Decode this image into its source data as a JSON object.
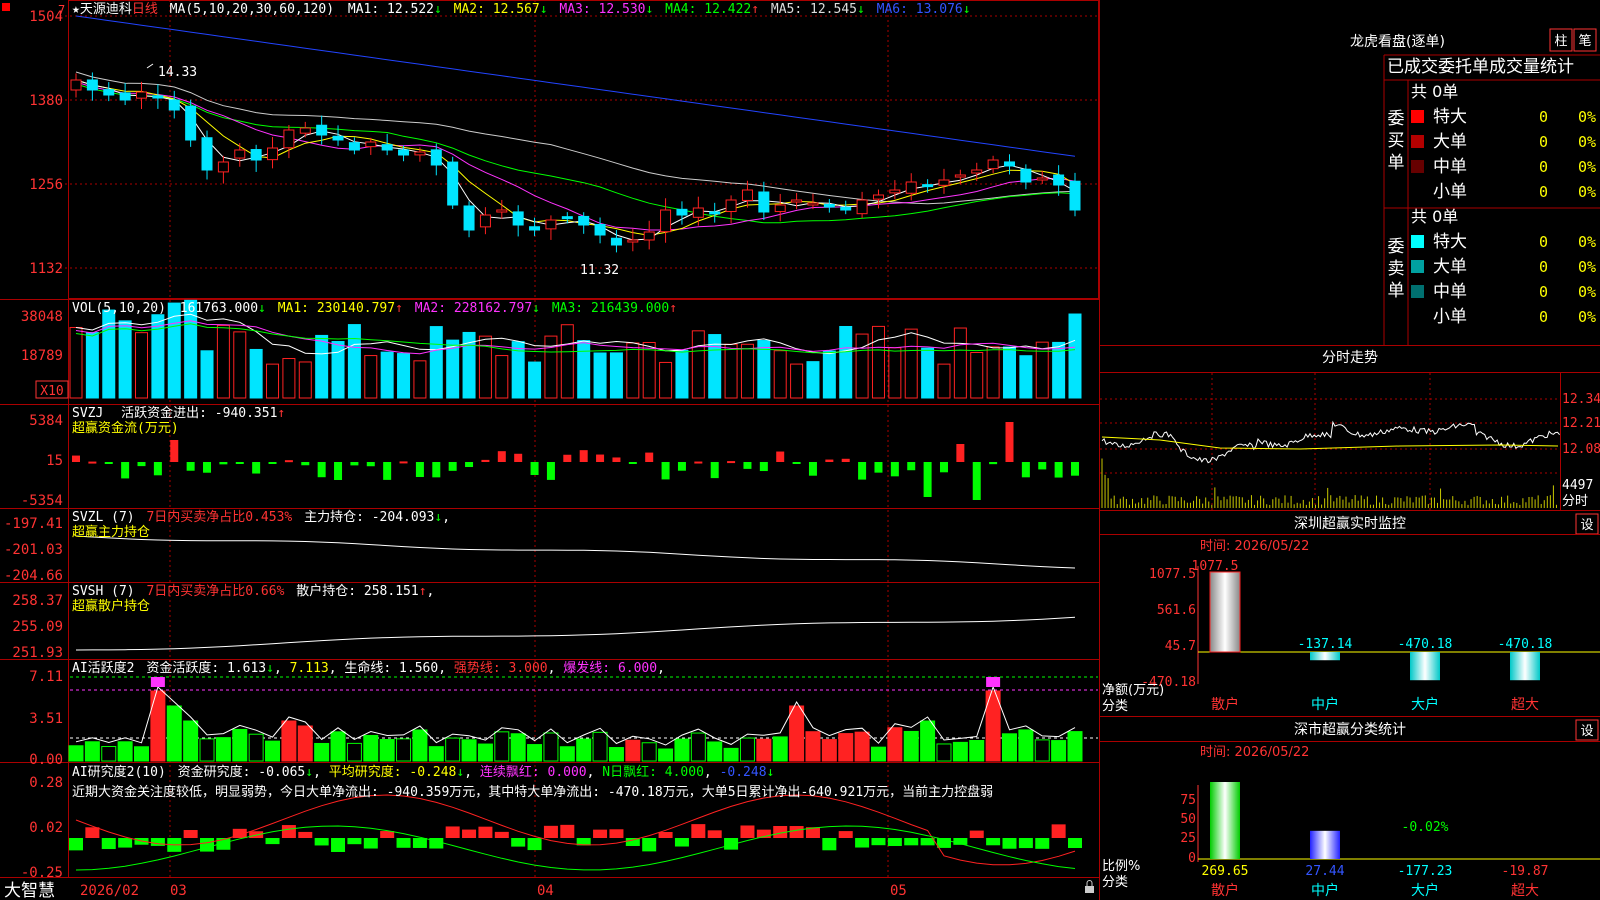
{
  "stock": {
    "name": "★天源迪科",
    "period": "日线",
    "ma_label": "MA(5,10,20,30,60,120)",
    "ma": [
      {
        "label": "MA1: 12.522",
        "arrow": "↓",
        "color": "#ffffff"
      },
      {
        "label": "MA2: 12.567",
        "arrow": "↓",
        "color": "#ffff00"
      },
      {
        "label": "MA3: 12.530",
        "arrow": "↓",
        "color": "#ff33ff"
      },
      {
        "label": "MA4: 12.422",
        "arrow": "↑",
        "color": "#00ff00"
      },
      {
        "label": "MA5: 12.545",
        "arrow": "↓",
        "color": "#dddddd"
      },
      {
        "label": "MA6: 13.076",
        "arrow": "↓",
        "color": "#3355ff"
      }
    ],
    "y_ticks": [
      "1504",
      "1380",
      "1256",
      "1132"
    ],
    "annot_high": "14.33",
    "annot_low": "11.32",
    "top_left_mark": "7"
  },
  "vol": {
    "label": "VOL(5,10,20)",
    "value": "161763.000",
    "value_arrow": "↓",
    "ma": [
      {
        "label": "MA1: 230140.797",
        "arrow": "↑",
        "color": "#ffffff"
      },
      {
        "label": "MA2: 228162.797",
        "arrow": "↓",
        "color": "#ff33ff"
      },
      {
        "label": "MA3: 216439.000",
        "arrow": "↑",
        "color": "#00ff00"
      }
    ],
    "y_ticks": [
      "38048",
      "18789"
    ],
    "unit": "X10"
  },
  "svzj": {
    "label": "SVZJ",
    "field": "活跃资金进出: -940.351",
    "arrow": "↑",
    "sub": "超赢资金流(万元)",
    "y_ticks": [
      "5384",
      "15",
      "-5354"
    ]
  },
  "svzl": {
    "label": "SVZL (7)",
    "ratio": "7日内买卖净占比0.453%",
    "field": "主力持仓: -204.093",
    "arrow": "↓",
    "sub": "超赢主力持仓",
    "y_ticks": [
      "-197.41",
      "-201.03",
      "-204.66"
    ]
  },
  "svsh": {
    "label": "SVSH (7)",
    "ratio": "7日内买卖净占比0.66%",
    "field": "散户持仓: 258.151",
    "arrow": "↑",
    "sub": "超赢散户持仓",
    "y_ticks": [
      "258.37",
      "255.09",
      "251.93"
    ]
  },
  "ai1": {
    "label": "AI活跃度2",
    "field1": "资金活跃度: 1.613",
    "arrow1": "↓",
    "field2": "7.113",
    "field3": "生命线: 1.560",
    "field4": "强势线: 3.000",
    "field5": "爆发线: 6.000",
    "y_ticks": [
      "7.11",
      "3.51",
      "0.00"
    ]
  },
  "ai2": {
    "label": "AI研究度2(10)",
    "field1": "资金研究度: -0.065",
    "arrow1": "↓",
    "field2": "平均研究度: -0.248",
    "arrow2": "↓",
    "field3": "连续飘红: 0.000",
    "field4": "N日飘红: 4.000",
    "field5": "-0.248",
    "note": "近期大资金关注度较低，明显弱势，今日大单净流出: -940.359万元，其中特大单净流出: -470.18万元，大单5日累计净出-640.921万元，当前主力控盘弱",
    "y_ticks": [
      "0.28",
      "0.02",
      "-0.25"
    ]
  },
  "xaxis": {
    "left": "大智慧",
    "labels": [
      "2026/02",
      "03",
      "04",
      "05"
    ]
  },
  "lhb": {
    "title": "龙虎看盘(逐单)",
    "btn1": "柱",
    "btn2": "笔",
    "header": "已成交委托单成交量统计",
    "buy_label": "委买单",
    "sell_label": "委卖单",
    "buy_total": "共 0单",
    "sell_total": "共 0单",
    "buy_rows": [
      {
        "label": "特大",
        "value": "0",
        "pct": "0%",
        "color": "#ff0000"
      },
      {
        "label": "大单",
        "value": "0",
        "pct": "0%",
        "color": "#b30000"
      },
      {
        "label": "中单",
        "value": "0",
        "pct": "0%",
        "color": "#660000"
      },
      {
        "label": "小单",
        "value": "0",
        "pct": "0%",
        "color": ""
      }
    ],
    "sell_rows": [
      {
        "label": "特大",
        "value": "0",
        "pct": "0%",
        "color": "#00ffff"
      },
      {
        "label": "大单",
        "value": "0",
        "pct": "0%",
        "color": "#00a0a0"
      },
      {
        "label": "中单",
        "value": "0",
        "pct": "0%",
        "color": "#007070"
      },
      {
        "label": "小单",
        "value": "0",
        "pct": "0%",
        "color": ""
      }
    ]
  },
  "intraday": {
    "title": "分时走势",
    "price_ticks": [
      "12.34",
      "12.21",
      "12.08"
    ],
    "vol_tick": "4497",
    "vol_unit": "分时"
  },
  "realtime": {
    "title": "深圳超赢实时监控",
    "btn": "设",
    "time": "时间: 2026/05/22",
    "y_ticks": [
      "1077.5",
      "561.6",
      "45.7",
      "-470.18"
    ],
    "unit": "净额(万元)",
    "cat_label": "分类",
    "chart_data": {
      "type": "bar",
      "categories": [
        "散户",
        "中户",
        "大户",
        "超大"
      ],
      "values": [
        1077.5,
        -137.14,
        -470.18,
        -470.18
      ],
      "value_labels": [
        "1077.5",
        "-137.14",
        "-470.18",
        "-470.18"
      ],
      "ylim": [
        -470.18,
        1077.5
      ]
    }
  },
  "category": {
    "title": "深市超赢分类统计",
    "btn": "设",
    "time": "时间: 2026/05/22",
    "y_ticks": [
      "75",
      "50",
      "25",
      "0"
    ],
    "unit": "比例%",
    "cat_label": "分类",
    "note_pct": "-0.02%",
    "chart_data": {
      "type": "bar",
      "categories": [
        "散户",
        "中户",
        "大户",
        "超大"
      ],
      "values": [
        269.65,
        27.44,
        -177.23,
        -19.87
      ],
      "value_labels": [
        "269.65",
        "27.44",
        "-177.23",
        "-19.87"
      ],
      "ylim": [
        0,
        75
      ]
    }
  }
}
